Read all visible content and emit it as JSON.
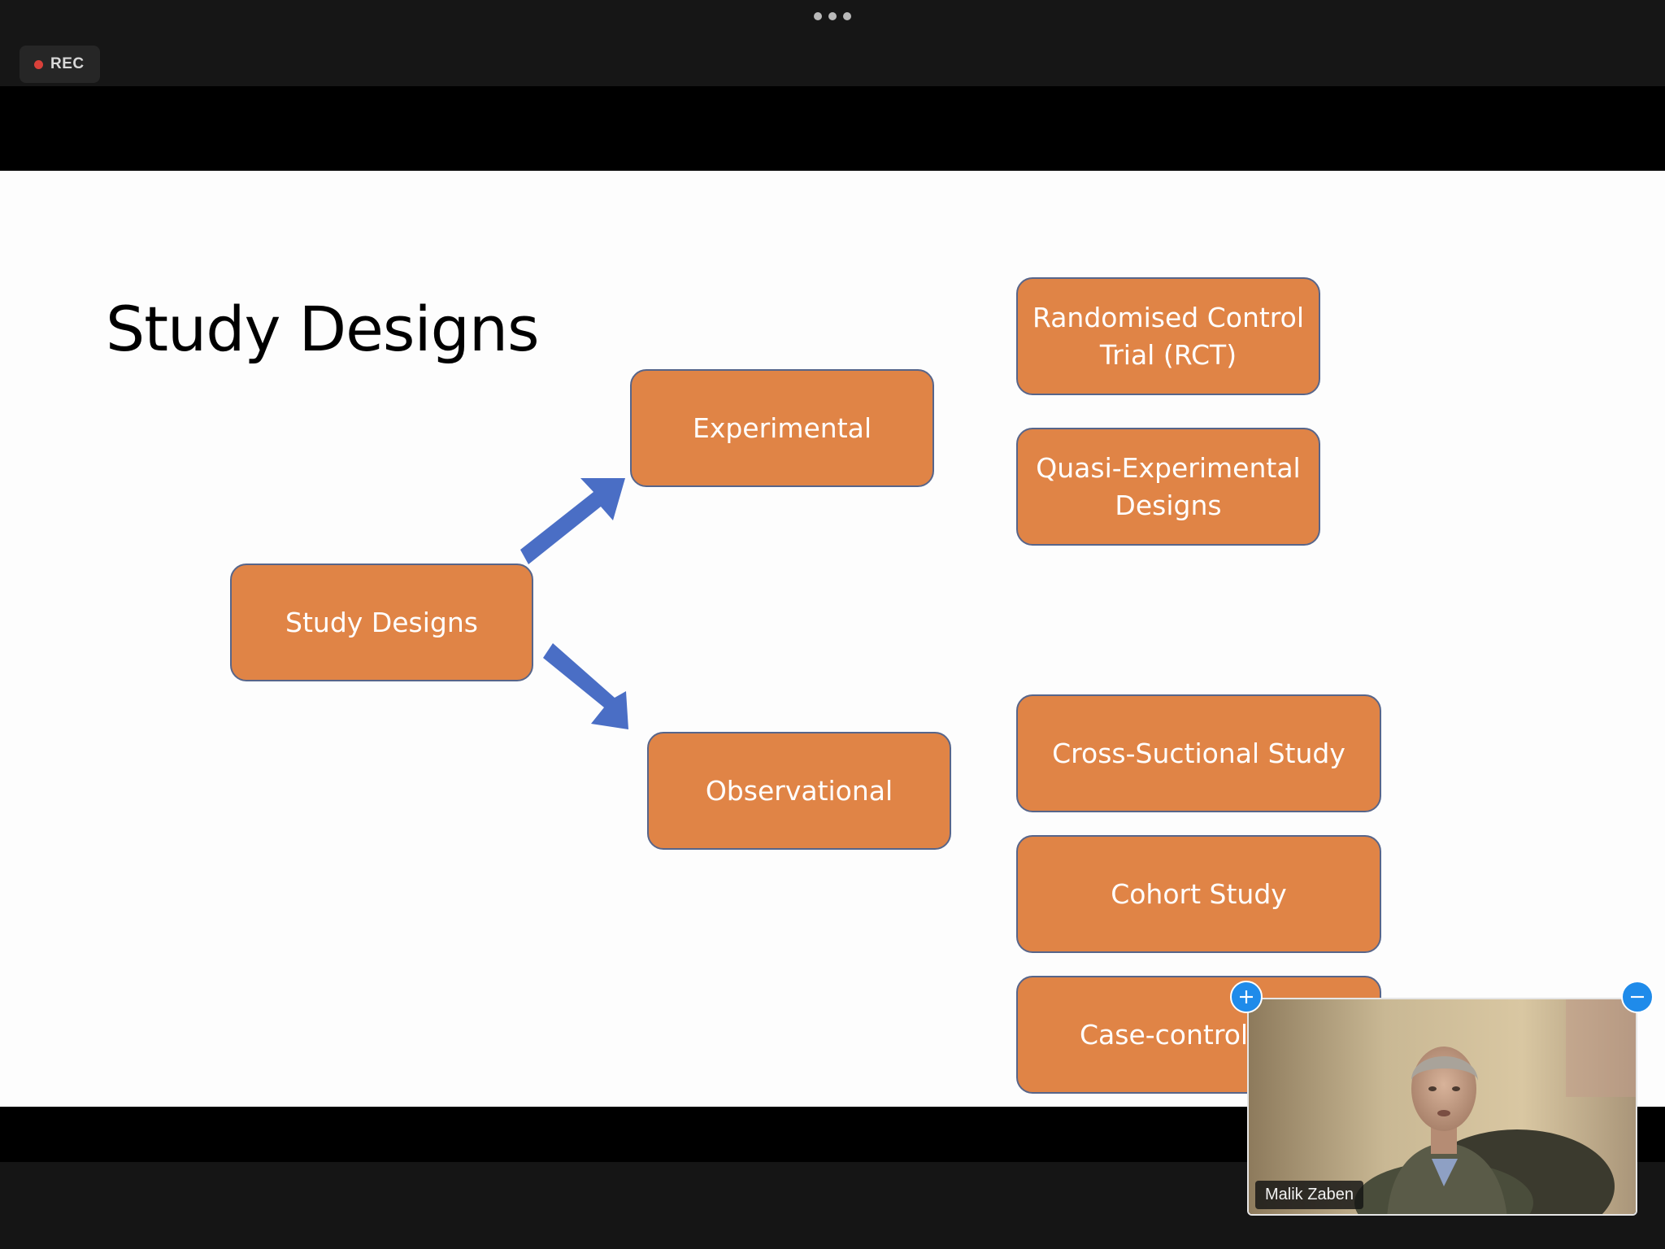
{
  "window": {
    "more_icon": "more-horizontal-icon",
    "rec_label": "REC",
    "rec_color": "#d9403a"
  },
  "slide": {
    "title": "Study Designs",
    "box_color": "#e08446",
    "border_color": "#57658a",
    "arrow_color": "#4a6ec5",
    "root": "Study Designs",
    "branches": {
      "experimental": "Experimental",
      "observational": "Observational"
    },
    "experimental_items": [
      "Randomised Control Trial (RCT)",
      "Quasi-Experimental Designs"
    ],
    "observational_items": [
      "Cross-Suctional Study",
      "Cohort Study",
      "Case-control"
    ]
  },
  "video": {
    "participant_name": "Malik Zaben",
    "expand_icon": "plus-icon",
    "collapse_icon": "minus-icon",
    "accent": "#1f8bea"
  }
}
